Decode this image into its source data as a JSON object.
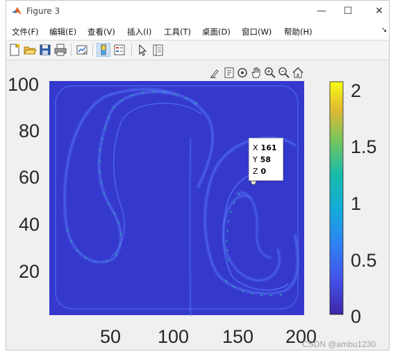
{
  "window": {
    "title": "Figure 3",
    "minimize": "—",
    "maximize": "☐",
    "close": "✕"
  },
  "menu": [
    "文件(F)",
    "编辑(E)",
    "查看(V)",
    "插入(I)",
    "工具(T)",
    "桌面(D)",
    "窗口(W)",
    "帮助(H)"
  ],
  "menu_overflow": "↘",
  "toolbar": [
    "new-figure-icon",
    "open-icon",
    "save-icon",
    "print-icon",
    "link-plot-icon",
    "insert-colorbar-icon",
    "insert-legend-icon",
    "edit-plot-icon",
    "property-inspector-icon"
  ],
  "axes_toolbar": [
    "brush-icon",
    "data-tips-icon",
    "rotate-icon",
    "pan-icon",
    "zoom-in-icon",
    "zoom-out-icon",
    "home-icon"
  ],
  "chart_data": {
    "type": "heatmap",
    "xlim": [
      1,
      200
    ],
    "ylim": [
      1,
      100
    ],
    "x_ticks": [
      "50",
      "100",
      "150",
      "200"
    ],
    "y_ticks": [
      "100",
      "80",
      "60",
      "40",
      "20"
    ],
    "colorbar": {
      "colormap": "parula",
      "range": [
        0,
        2.1
      ],
      "ticks": [
        "2",
        "1.5",
        "1",
        "0.5",
        "0"
      ]
    },
    "datatip": {
      "x": {
        "label": "X",
        "value": "161"
      },
      "y": {
        "label": "Y",
        "value": "58"
      },
      "z": {
        "label": "Z",
        "value": "0"
      }
    },
    "colors": {
      "background": "#3538cd",
      "ridge": "#4f6ff0",
      "peak": "#26c4a0",
      "max": "#f9fb14"
    }
  },
  "watermark": "CSDN @ambu1230"
}
